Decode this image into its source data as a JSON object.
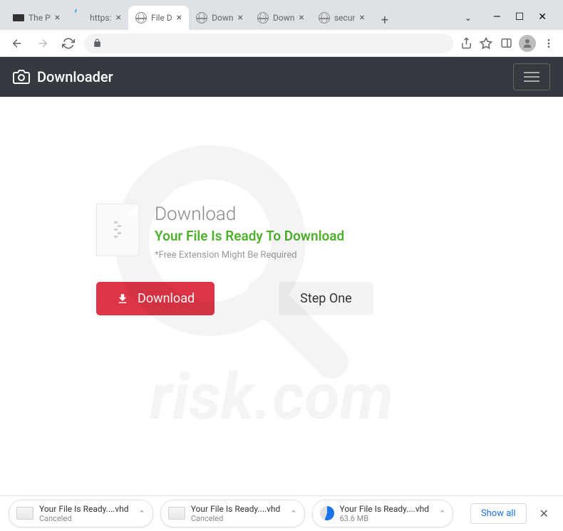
{
  "tabs": [
    {
      "title": "The P",
      "favicon": "dark"
    },
    {
      "title": "https:",
      "favicon": "apostrophe"
    },
    {
      "title": "File D",
      "favicon": "globe",
      "active": true
    },
    {
      "title": "Down",
      "favicon": "globe"
    },
    {
      "title": "Down",
      "favicon": "globe"
    },
    {
      "title": "secur",
      "favicon": "globe"
    }
  ],
  "header": {
    "brand": "Downloader"
  },
  "card": {
    "heading": "Download",
    "subheading": "Your File Is Ready To Download",
    "note": "*Free Extension Might Be Required",
    "download_btn": "Download",
    "step_btn": "Step One"
  },
  "downloads": {
    "items": [
      {
        "name": "Your File Is Ready....vhd",
        "status": "Canceled",
        "icon": "disk"
      },
      {
        "name": "Your File Is Ready....vhd",
        "status": "Canceled",
        "icon": "disk"
      },
      {
        "name": "Your File Is Ready....vhd",
        "status": "63.6 MB",
        "icon": "spinning"
      }
    ],
    "show_all": "Show all"
  }
}
